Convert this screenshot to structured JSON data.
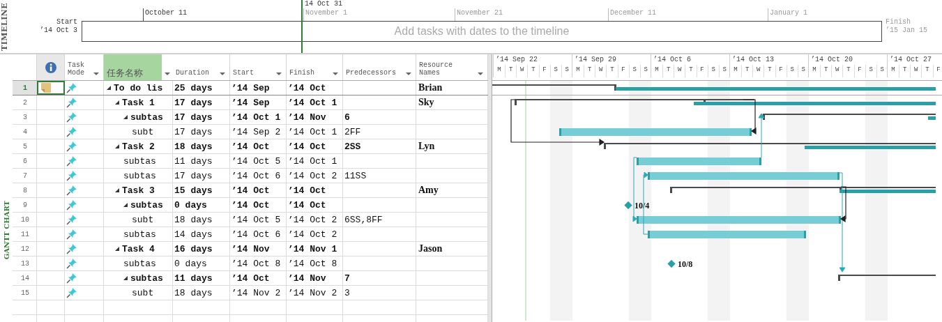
{
  "timeline": {
    "side_label": "TIMELINE",
    "today_label": "14 Oct 31",
    "ticks": [
      "October 11",
      "November 1",
      "November 21",
      "December 11",
      "January 1"
    ],
    "start_label": "Start",
    "start_date": "’14 Oct 3",
    "finish_label": "Finish",
    "finish_date": "’15 Jan 15",
    "placeholder": "Add tasks with dates to the timeline"
  },
  "view_label": "GANTT CHART",
  "columns": [
    {
      "label": "Task Mode",
      "selected": false
    },
    {
      "label": "任务名称",
      "selected": true
    },
    {
      "label": "Duration",
      "selected": false
    },
    {
      "label": "Start",
      "selected": false
    },
    {
      "label": "Finish",
      "selected": false
    },
    {
      "label": "Predecessors",
      "selected": false
    },
    {
      "label": "Resource Names",
      "selected": false
    }
  ],
  "tasks": [
    {
      "id": "1",
      "name": "To do lis",
      "duration": "25 days",
      "start": "’14 Sep",
      "finish": "’14 Oct",
      "resources": "Brian",
      "summary": true,
      "expanded": true,
      "selected": true,
      "note": true,
      "children": [
        {
          "id": "2",
          "name": "Task 1",
          "duration": "17 days",
          "start": "’14 Sep",
          "finish": "’14 Oct 1",
          "resources": "Sky",
          "summary": true,
          "expanded": true,
          "selected": false,
          "note": false,
          "children": [
            {
              "id": "3",
              "name": "subtas",
              "duration": "17 days",
              "start": "’14 Oct 1",
              "finish": "’14 Nov",
              "predecessors": "6",
              "summary": true,
              "expanded": true,
              "selected": false,
              "note": false,
              "children": [
                {
                  "id": "4",
                  "name": "subt",
                  "duration": "17 days",
                  "start": "’14 Sep 2",
                  "finish": "’14 Oct 1",
                  "predecessors": "2FF",
                  "summary": false,
                  "selected": false,
                  "note": false
                }
              ]
            }
          ]
        },
        {
          "id": "5",
          "name": "Task 2",
          "duration": "18 days",
          "start": "’14 Oct",
          "finish": "’14 Oct",
          "predecessors": "2SS",
          "resources": "Lyn",
          "summary": true,
          "expanded": true,
          "selected": false,
          "note": false,
          "children": [
            {
              "id": "6",
              "name": "subtas",
              "duration": "11 days",
              "start": "’14 Oct 5",
              "finish": "’14 Oct 1",
              "summary": false,
              "selected": false,
              "note": false
            },
            {
              "id": "7",
              "name": "subtas",
              "duration": "17 days",
              "start": "’14 Oct 6",
              "finish": "’14 Oct 2",
              "predecessors": "11SS",
              "summary": false,
              "selected": false,
              "note": false
            }
          ]
        },
        {
          "id": "8",
          "name": "Task 3",
          "duration": "15 days",
          "start": "’14 Oct",
          "finish": "’14 Oct",
          "resources": "Amy",
          "summary": true,
          "expanded": true,
          "selected": false,
          "note": false,
          "children": [
            {
              "id": "9",
              "name": "subtas",
              "duration": "0 days",
              "start": "’14 Oct",
              "finish": "’14 Oct",
              "summary": true,
              "expanded": true,
              "selected": false,
              "note": false,
              "children": [
                {
                  "id": "10",
                  "name": "subt",
                  "duration": "18 days",
                  "start": "’14 Oct 5",
                  "finish": "’14 Oct 2",
                  "predecessors": "6SS,8FF",
                  "summary": false,
                  "selected": false,
                  "note": false
                }
              ]
            },
            {
              "id": "11",
              "name": "subtas",
              "duration": "14 days",
              "start": "’14 Oct 6",
              "finish": "’14 Oct 2",
              "summary": false,
              "selected": false,
              "note": false
            }
          ]
        },
        {
          "id": "12",
          "name": "Task 4",
          "duration": "16 days",
          "start": "’14 Nov",
          "finish": "’14 Nov 1",
          "resources": "Jason",
          "summary": true,
          "expanded": true,
          "selected": false,
          "note": false,
          "children": [
            {
              "id": "13",
              "name": "subtas",
              "duration": "0 days",
              "start": "’14 Oct 8",
              "finish": "’14 Oct 8",
              "summary": false,
              "selected": false,
              "note": false
            },
            {
              "id": "14",
              "name": "subtas",
              "duration": "11 days",
              "start": "’14 Oct",
              "finish": "’14 Nov",
              "predecessors": "7",
              "summary": true,
              "expanded": true,
              "selected": false,
              "note": false,
              "children": [
                {
                  "id": "15",
                  "name": "subt",
                  "duration": "18 days",
                  "start": "’14 Nov 2",
                  "finish": "’14 Nov 2",
                  "predecessors": "3",
                  "summary": false,
                  "selected": false,
                  "note": false
                }
              ]
            }
          ]
        }
      ]
    }
  ],
  "gantt": {
    "weeks": [
      {
        "label": "’14 Sep 22",
        "days": [
          "M",
          "T",
          "W",
          "T",
          "F",
          "S",
          "S"
        ]
      },
      {
        "label": "’14 Sep 29",
        "days": [
          "M",
          "T",
          "W",
          "T",
          "F",
          "S",
          "S"
        ]
      },
      {
        "label": "’14 Oct 6",
        "days": [
          "M",
          "T",
          "W",
          "T",
          "F",
          "S",
          "S"
        ]
      },
      {
        "label": "’14 Oct 13",
        "days": [
          "M",
          "T",
          "W",
          "T",
          "F",
          "S",
          "S"
        ]
      },
      {
        "label": "’14 Oct 20",
        "days": [
          "M",
          "T",
          "W",
          "T",
          "F",
          "S",
          "S"
        ]
      },
      {
        "label": "’14 Oct 27",
        "days": [
          "M",
          "T",
          "W",
          "T",
          "F"
        ]
      }
    ],
    "milestones": [
      {
        "label": "10/4"
      },
      {
        "label": "10/8"
      }
    ]
  }
}
